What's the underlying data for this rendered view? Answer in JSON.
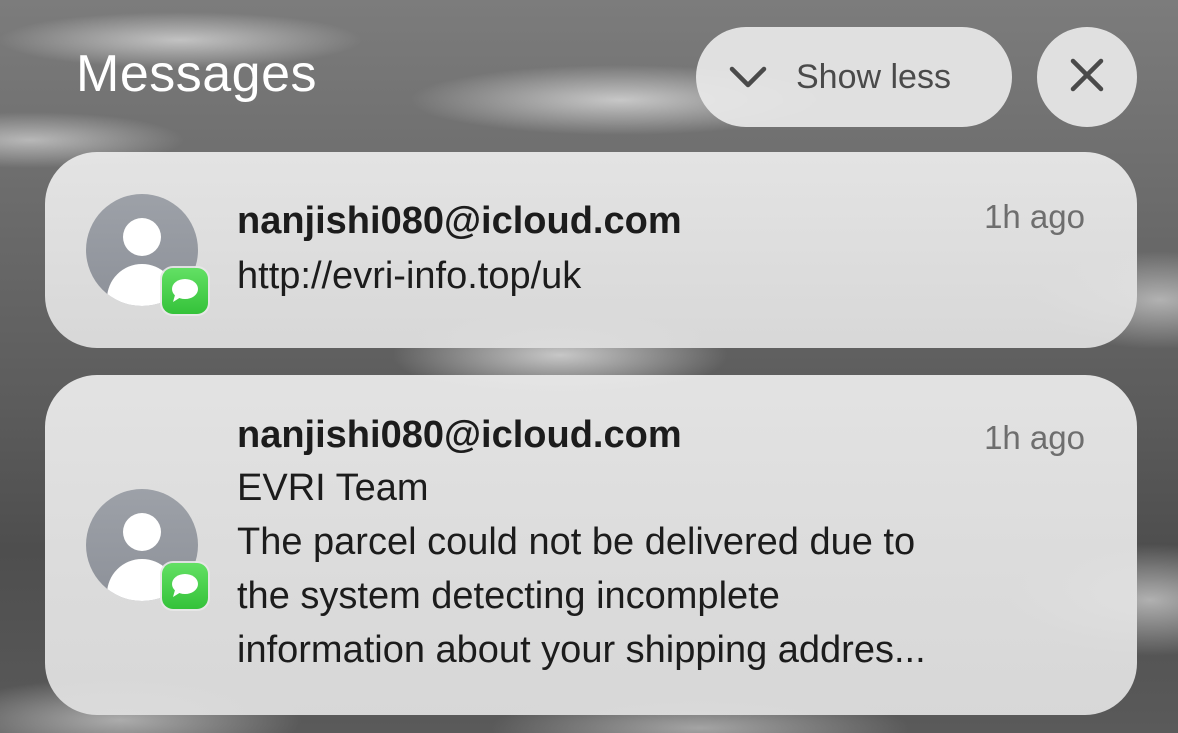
{
  "header": {
    "title": "Messages",
    "show_less_label": "Show less",
    "chevron_icon": "chevron-down-icon",
    "close_icon": "close-icon"
  },
  "notifications": [
    {
      "sender": "nanjishi080@icloud.com",
      "time": "1h ago",
      "body": "http://evri-info.top/uk",
      "app_icon": "messages-icon",
      "avatar_icon": "person-icon"
    },
    {
      "sender": "nanjishi080@icloud.com",
      "time": "1h ago",
      "title": "EVRI Team",
      "body_lines": [
        "The parcel could not be delivered due to",
        "the system detecting incomplete",
        "information about your shipping addres..."
      ],
      "app_icon": "messages-icon",
      "avatar_icon": "person-icon"
    }
  ],
  "colors": {
    "messages_green": "#35c23a",
    "avatar_gray": "#8d9199",
    "card_background": "#e6e6e6"
  }
}
